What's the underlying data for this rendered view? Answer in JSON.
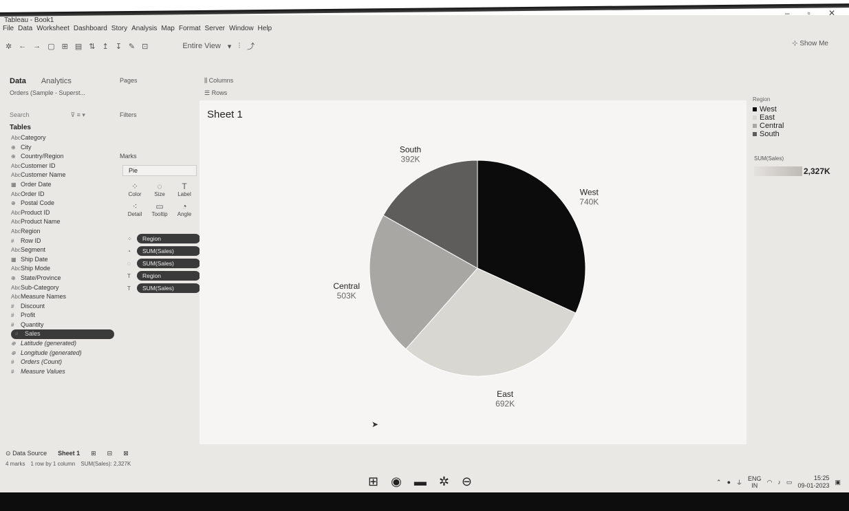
{
  "window": {
    "title": "Tableau - Book1",
    "controls": [
      "–",
      "▫",
      "✕"
    ]
  },
  "menu": [
    "File",
    "Data",
    "Worksheet",
    "Dashboard",
    "Story",
    "Analysis",
    "Map",
    "Format",
    "Server",
    "Window",
    "Help"
  ],
  "toolbar": {
    "view_select": "Entire View",
    "show_me": "Show Me"
  },
  "data_panel": {
    "tab_data": "Data",
    "tab_analytics": "Analytics",
    "datasource": "Orders (Sample - Superst...",
    "search_placeholder": "Search",
    "tables_header": "Tables",
    "fields": [
      {
        "icon": "Abc",
        "label": "Category"
      },
      {
        "icon": "⊕",
        "label": "City"
      },
      {
        "icon": "⊕",
        "label": "Country/Region"
      },
      {
        "icon": "Abc",
        "label": "Customer ID"
      },
      {
        "icon": "Abc",
        "label": "Customer Name"
      },
      {
        "icon": "▦",
        "label": "Order Date"
      },
      {
        "icon": "Abc",
        "label": "Order ID"
      },
      {
        "icon": "⊕",
        "label": "Postal Code"
      },
      {
        "icon": "Abc",
        "label": "Product ID"
      },
      {
        "icon": "Abc",
        "label": "Product Name"
      },
      {
        "icon": "Abc",
        "label": "Region"
      },
      {
        "icon": "#",
        "label": "Row ID"
      },
      {
        "icon": "Abc",
        "label": "Segment"
      },
      {
        "icon": "▦",
        "label": "Ship Date"
      },
      {
        "icon": "Abc",
        "label": "Ship Mode"
      },
      {
        "icon": "⊕",
        "label": "State/Province"
      },
      {
        "icon": "Abc",
        "label": "Sub-Category"
      },
      {
        "icon": "Abc",
        "label": "Measure Names"
      },
      {
        "icon": "#",
        "label": "Discount"
      },
      {
        "icon": "#",
        "label": "Profit"
      },
      {
        "icon": "#",
        "label": "Quantity"
      },
      {
        "icon": "#",
        "label": "Sales"
      },
      {
        "icon": "⊕",
        "label": "Latitude (generated)"
      },
      {
        "icon": "⊕",
        "label": "Longitude (generated)"
      },
      {
        "icon": "#",
        "label": "Orders (Count)"
      },
      {
        "icon": "#",
        "label": "Measure Values"
      }
    ]
  },
  "cards": {
    "pages": "Pages",
    "filters": "Filters",
    "marks": "Marks",
    "mark_type": "Pie",
    "mark_buttons": [
      {
        "icon": "⁘",
        "label": "Color"
      },
      {
        "icon": "◌",
        "label": "Size"
      },
      {
        "icon": "T",
        "label": "Label"
      },
      {
        "icon": "⁖",
        "label": "Detail"
      },
      {
        "icon": "▭",
        "label": "Tooltip"
      },
      {
        "icon": "◔",
        "label": "Angle"
      }
    ],
    "pills": [
      {
        "icon": "⁘",
        "label": "Region"
      },
      {
        "icon": "◔",
        "label": "SUM(Sales)"
      },
      {
        "icon": "◌",
        "label": "SUM(Sales)"
      },
      {
        "icon": "T",
        "label": "Region"
      },
      {
        "icon": "T",
        "label": "SUM(Sales)"
      }
    ]
  },
  "shelves": {
    "columns": "Columns",
    "rows": "Rows"
  },
  "sheet": {
    "title": "Sheet 1"
  },
  "chart_data": {
    "type": "pie",
    "categories": [
      "West",
      "East",
      "Central",
      "South"
    ],
    "values": [
      740,
      692,
      503,
      392
    ],
    "value_labels": [
      "740K",
      "692K",
      "503K",
      "392K"
    ],
    "colors": [
      "#0c0c0c",
      "#d9d7d2",
      "#a9a7a3",
      "#5e5d5b"
    ],
    "title": "",
    "legend_position": "right"
  },
  "legend": {
    "title": "Region",
    "items": [
      {
        "label": "West",
        "color": "#0c0c0c"
      },
      {
        "label": "East",
        "color": "#d9d7d2"
      },
      {
        "label": "Central",
        "color": "#a9a7a3"
      },
      {
        "label": "South",
        "color": "#5e5d5b"
      }
    ],
    "size_title": "SUM(Sales)",
    "size_value": "2,327K"
  },
  "sheet_tabs": {
    "data_source": "Data Source",
    "active_sheet": "Sheet 1"
  },
  "status": {
    "marks": "4 marks",
    "rows_cols": "1 row by 1 column",
    "sum": "SUM(Sales): 2,327K"
  },
  "tray": {
    "lang": "ENG",
    "region": "IN",
    "time": "15:25",
    "date": "09-01-2023"
  }
}
